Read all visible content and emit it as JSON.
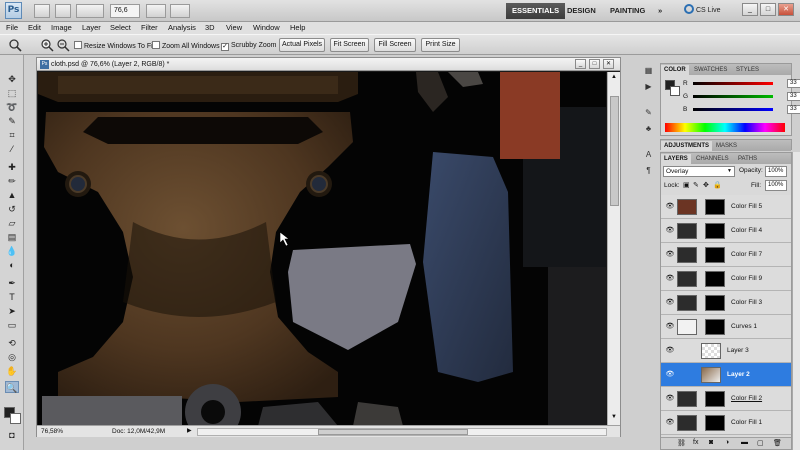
{
  "app": {
    "logo": "Ps",
    "zoom": "76,6",
    "workspaces": [
      "ESSENTIALS",
      "DESIGN",
      "PAINTING"
    ],
    "more": "»",
    "cs_live": "CS Live",
    "window_controls": [
      "_",
      "□",
      "✕"
    ]
  },
  "menu": [
    "File",
    "Edit",
    "Image",
    "Layer",
    "Select",
    "Filter",
    "Analysis",
    "3D",
    "View",
    "Window",
    "Help"
  ],
  "options": {
    "resize_windows": "Resize Windows To Fit",
    "zoom_all": "Zoom All Windows",
    "scrubby_zoom": "Scrubby Zoom",
    "buttons": [
      "Actual Pixels",
      "Fit Screen",
      "Fill Screen",
      "Print Size"
    ]
  },
  "document": {
    "title": "cloth.psd @ 76,6% (Layer 2, RGB/8) *",
    "zoom_status": "76,58%",
    "doc_info": "Doc: 12,0M/42,9M"
  },
  "color_panel": {
    "tabs": [
      "COLOR",
      "SWATCHES",
      "STYLES"
    ],
    "channels": [
      {
        "label": "R",
        "value": "33"
      },
      {
        "label": "G",
        "value": "33"
      },
      {
        "label": "B",
        "value": "33"
      }
    ]
  },
  "adjust_panel": {
    "tabs": [
      "ADJUSTMENTS",
      "MASKS"
    ]
  },
  "layers_panel": {
    "tabs": [
      "LAYERS",
      "CHANNELS",
      "PATHS"
    ],
    "blend_mode": "Overlay",
    "opacity_label": "Opacity:",
    "opacity": "100%",
    "lock_label": "Lock:",
    "fill_label": "Fill:",
    "fill": "100%",
    "layers": [
      {
        "name": "Color Fill 5",
        "color": "#6b3423"
      },
      {
        "name": "Color Fill 4",
        "color": "#2c2c2c"
      },
      {
        "name": "Color Fill 7",
        "color": "#2c2c2c"
      },
      {
        "name": "Color Fill 9",
        "color": "#2c2c2c"
      },
      {
        "name": "Color Fill 3",
        "color": "#2c2c2c"
      },
      {
        "name": "Curves 1",
        "color": "#ffffff"
      },
      {
        "name": "Layer 3",
        "color": "#ffffff"
      },
      {
        "name": "Layer 2",
        "color": "#8a6a4a"
      },
      {
        "name": "Color Fill 2",
        "color": "#2c2c2c"
      },
      {
        "name": "Color Fill 1",
        "color": "#2c2c2c"
      }
    ],
    "selected": "Layer 2"
  },
  "colors": {
    "accent": "#2e7ce0",
    "fabric_brown": "#5a3e22",
    "fabric_red": "#8a3a25",
    "fabric_blue": "#2f3c56",
    "fabric_gray": "#7a7a85"
  }
}
